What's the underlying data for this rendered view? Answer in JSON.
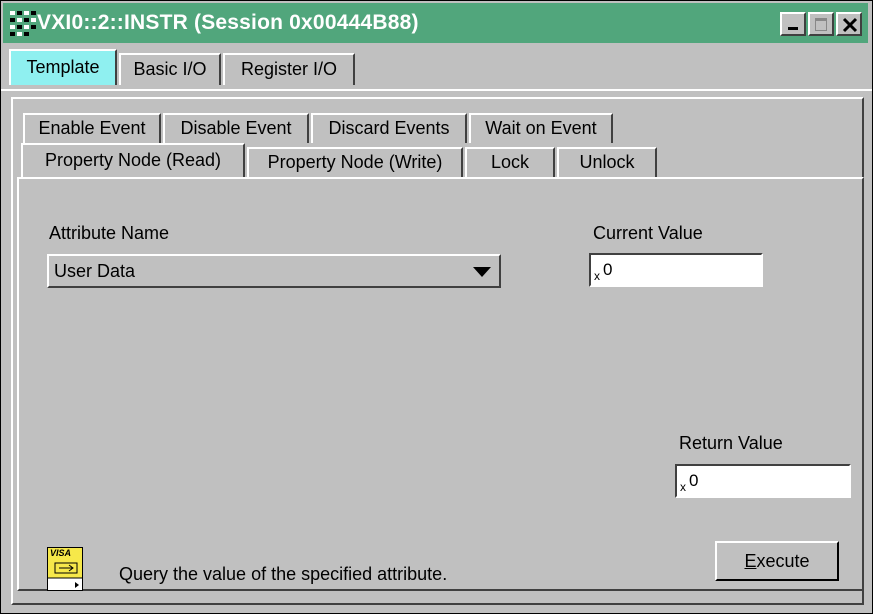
{
  "window": {
    "title": "VXI0::2::INSTR (Session 0x00444B88)",
    "titlebar_color": "#51a67c"
  },
  "top_tabs": [
    {
      "label": "Template",
      "active": true
    },
    {
      "label": "Basic I/O",
      "active": false
    },
    {
      "label": "Register I/O",
      "active": false
    }
  ],
  "event_tabs_row1": [
    "Enable Event",
    "Disable Event",
    "Discard Events",
    "Wait on Event"
  ],
  "event_tabs_row2": [
    "Property Node (Read)",
    "Property Node (Write)",
    "Lock",
    "Unlock"
  ],
  "active_tab": "Property Node (Read)",
  "form": {
    "attribute_name_label": "Attribute Name",
    "attribute_name_value": "User Data",
    "current_value_label": "Current Value",
    "current_value": "0",
    "return_value_label": "Return Value",
    "return_value": "0",
    "radix_marker": "x"
  },
  "footer": {
    "visa_badge": "VISA",
    "description": "Query the value of the specified attribute.",
    "execute_prefix": "E",
    "execute_rest": "xecute"
  },
  "icons": [
    "app-icon",
    "minimize-icon",
    "maximize-icon",
    "close-icon",
    "dropdown-arrow-icon",
    "visa-icon"
  ]
}
